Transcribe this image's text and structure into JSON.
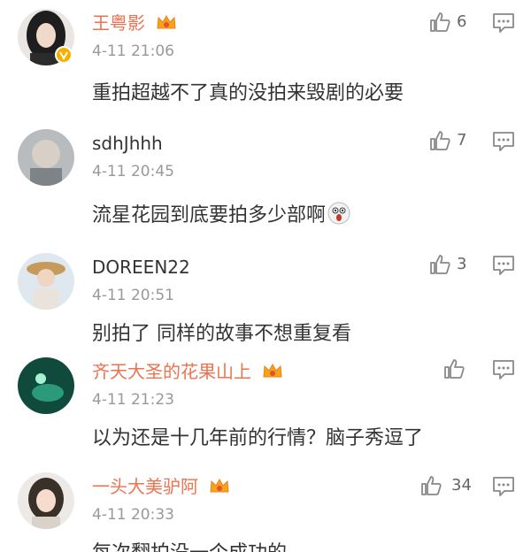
{
  "comments": [
    {
      "user": "王粤影",
      "vip": true,
      "verified": true,
      "time": "4-11 21:06",
      "text": "重拍超越不了真的没拍来毁剧的必要",
      "likes": "6",
      "avatar_color": "#2a2a2a"
    },
    {
      "user": "sdhJhhh",
      "vip": false,
      "verified": false,
      "time": "4-11 20:45",
      "text": "流星花园到底要拍多少部啊",
      "likes": "7",
      "avatar_color": "#9aa0a6",
      "emoji": "shocked-face-emoji"
    },
    {
      "user": "DOREEN22",
      "vip": false,
      "verified": false,
      "time": "4-11 20:51",
      "text": "别拍了 同样的故事不想重复看",
      "likes": "3",
      "avatar_color": "#c8b08a"
    },
    {
      "user": "齐天大圣的花果山上",
      "vip": true,
      "verified": false,
      "time": "4-11 21:23",
      "text": "以为还是十几年前的行情？脑子秀逗了",
      "likes": "",
      "avatar_color": "#1d6b58"
    },
    {
      "user": "一头大美驴阿",
      "vip": true,
      "verified": false,
      "time": "4-11 20:33",
      "text": "每次翻拍没一个成功的",
      "likes": "34",
      "avatar_color": "#e8e4e0"
    }
  ],
  "colors": {
    "vip_name": "#eb7350",
    "meta": "#999999",
    "text": "#333333",
    "icon": "#888888"
  }
}
